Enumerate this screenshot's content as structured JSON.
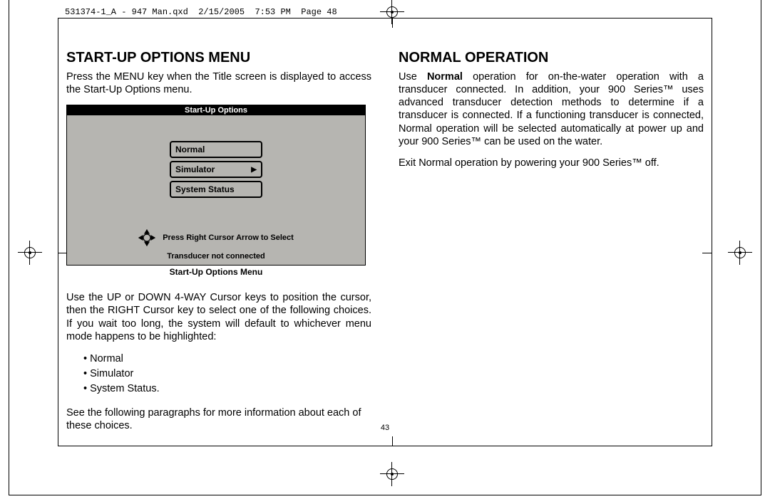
{
  "print_header": "531374-1_A - 947 Man.qxd  2/15/2005  7:53 PM  Page 48",
  "page_number": "43",
  "left": {
    "heading": "START-UP OPTIONS MENU",
    "intro": "Press the MENU key when the Title screen is displayed to access the Start-Up Options menu.",
    "device": {
      "title": "Start-Up Options",
      "options": [
        "Normal",
        "Simulator",
        "System Status"
      ],
      "selected_index": 1,
      "hint": "Press Right Cursor Arrow to Select",
      "status": "Transducer not connected"
    },
    "caption": "Start-Up Options Menu",
    "para2": "Use the UP or DOWN 4-WAY Cursor keys to position the cursor, then the RIGHT Cursor key to select one of the following choices. If you wait too long, the system will default to whichever menu mode happens to be highlighted:",
    "bullets": [
      "Normal",
      "Simulator",
      "System Status."
    ],
    "para3": "See the following paragraphs for more information about each of these choices."
  },
  "right": {
    "heading": "NORMAL OPERATION",
    "para1_pre": "Use ",
    "para1_bold": "Normal",
    "para1_post": " operation for on-the-water operation with a transducer connected. In addition, your 900 Series™ uses advanced transducer detection methods to determine if a transducer is connected. If a functioning transducer is connected, Normal operation will be selected automatically at power up and your 900 Series™ can be used on the water.",
    "para2": "Exit Normal operation by powering your 900 Series™ off."
  }
}
